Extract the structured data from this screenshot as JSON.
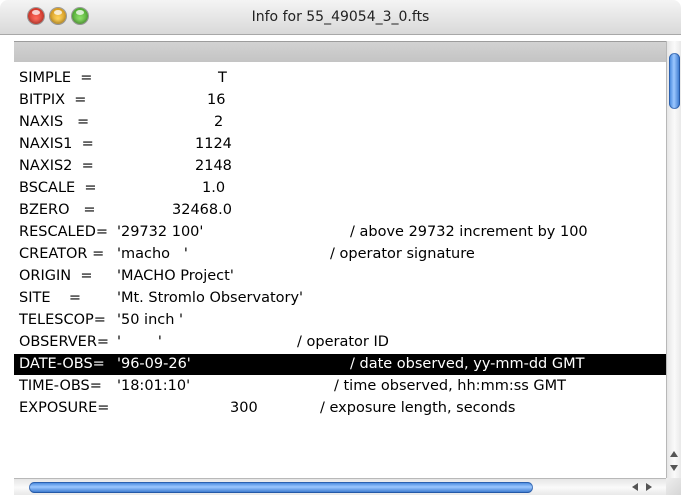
{
  "window": {
    "title": "Info for 55_49054_3_0.fts"
  },
  "header_rows": [
    {
      "key": "SIMPLE  =",
      "value": "T",
      "comment": ""
    },
    {
      "key": "BITPIX  =",
      "value": "16",
      "comment": ""
    },
    {
      "key": "NAXIS   =",
      "value": "2",
      "comment": ""
    },
    {
      "key": "NAXIS1  =",
      "value": "1124",
      "comment": ""
    },
    {
      "key": "NAXIS2  =",
      "value": "2148",
      "comment": ""
    },
    {
      "key": "BSCALE  =",
      "value": "1.0",
      "comment": ""
    },
    {
      "key": "BZERO   =",
      "value": "32468.0",
      "comment": ""
    },
    {
      "key": "RESCALED=",
      "value": "'29732 100'",
      "comment": "/ above 29732 increment by 100"
    },
    {
      "key": "CREATOR =",
      "value": "'macho   '",
      "comment": "/ operator signature"
    },
    {
      "key": "ORIGIN  =",
      "value": "'MACHO Project'",
      "comment": ""
    },
    {
      "key": "SITE    =",
      "value": "'Mt. Stromlo Observatory'",
      "comment": ""
    },
    {
      "key": "TELESCOP=",
      "value": "'50 inch '",
      "comment": ""
    },
    {
      "key": "OBSERVER=",
      "value": "'        '",
      "comment": "/ operator ID"
    },
    {
      "key": "DATE-OBS=",
      "value": "'96-09-26'",
      "comment": "/ date observed, yy-mm-dd GMT"
    },
    {
      "key": "TIME-OBS=",
      "value": "'18:01:10'",
      "comment": "/ time observed, hh:mm:ss GMT"
    },
    {
      "key": "EXPOSURE=",
      "value": "300",
      "comment": "/ exposure length, seconds"
    }
  ],
  "selected_row": "DATE-OBS=",
  "colors": {
    "selection_bg": "#000000",
    "selection_fg": "#ffffff",
    "scroll_thumb": "#5a9cf0"
  }
}
